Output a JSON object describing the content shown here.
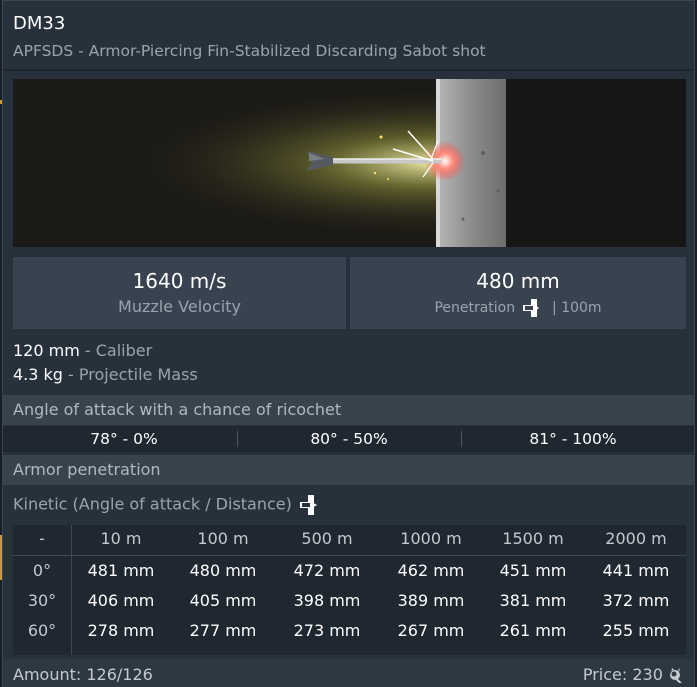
{
  "header": {
    "title": "DM33",
    "subtitle": "APFSDS - Armor-Piercing Fin-Stabilized Discarding Sabot shot"
  },
  "hero": {
    "icon": "apfsds-penetration-illustration"
  },
  "stats": {
    "velocity_value": "1640 m/s",
    "velocity_label": "Muzzle Velocity",
    "penetration_value": "480 mm",
    "penetration_label": "Penetration",
    "penetration_distance": "| 100m"
  },
  "properties": [
    {
      "value": "120 mm",
      "label": " - Caliber"
    },
    {
      "value": "4.3 kg",
      "label": " - Projectile Mass"
    }
  ],
  "ricochet": {
    "title": "Angle of attack with a chance of ricochet",
    "entries": [
      "78° - 0%",
      "80° - 50%",
      "81° - 100%"
    ]
  },
  "armor": {
    "title": "Armor penetration",
    "kinetic_label": "Kinetic (Angle of attack / Distance)",
    "corner": "-",
    "distances": [
      "10 m",
      "100 m",
      "500 m",
      "1000 m",
      "1500 m",
      "2000 m"
    ],
    "rows": [
      {
        "angle": "0°",
        "values": [
          "481 mm",
          "480 mm",
          "472 mm",
          "462 mm",
          "451 mm",
          "441 mm"
        ]
      },
      {
        "angle": "30°",
        "values": [
          "406 mm",
          "405 mm",
          "398 mm",
          "389 mm",
          "381 mm",
          "372 mm"
        ]
      },
      {
        "angle": "60°",
        "values": [
          "278 mm",
          "277 mm",
          "273 mm",
          "267 mm",
          "261 mm",
          "255 mm"
        ]
      }
    ]
  },
  "footer": {
    "amount": "Amount: 126/126",
    "price": "Price: 230"
  },
  "colors": {
    "panel": "#27313c",
    "section": "#39434e",
    "table": "#1f2730",
    "accent": "#c79a3a"
  }
}
